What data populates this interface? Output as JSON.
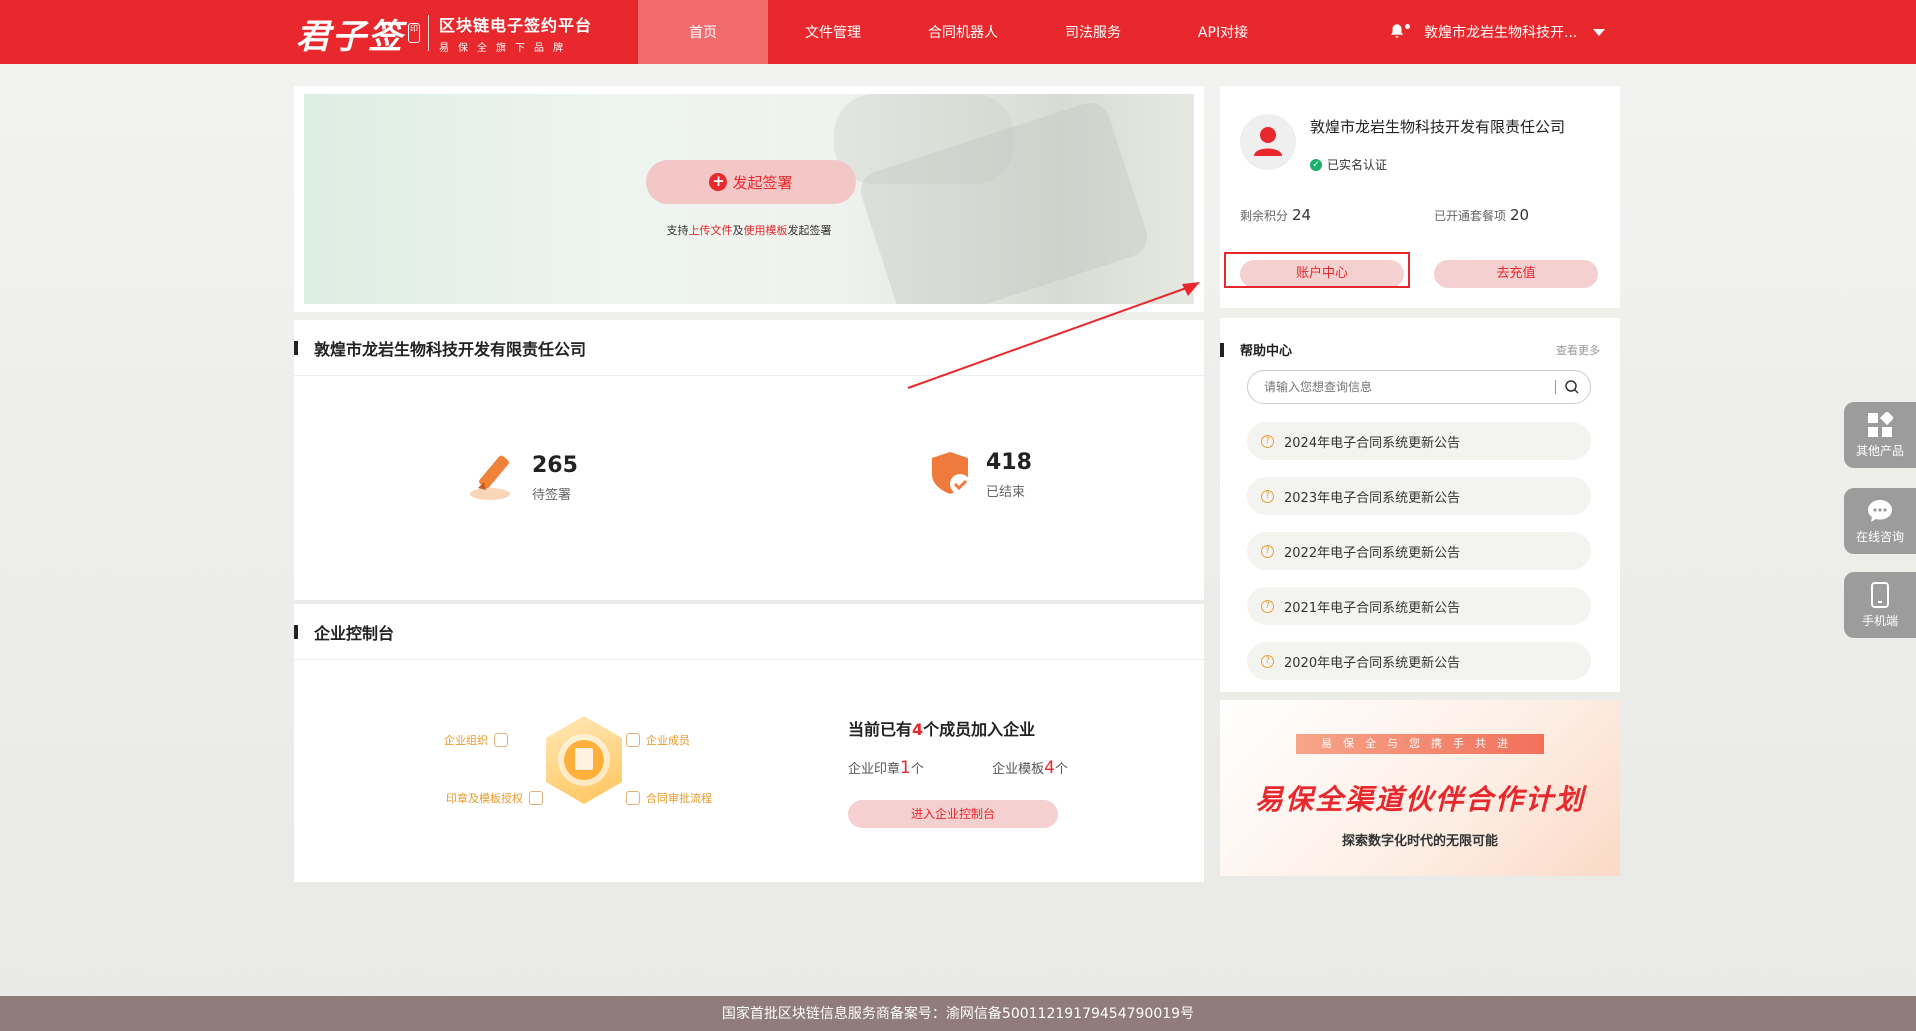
{
  "brand": {
    "logo_mark": "君子签",
    "seal": "印",
    "title": "区块链电子签约平台",
    "subtitle": "易保全旗下品牌"
  },
  "nav": {
    "items": [
      "首页",
      "文件管理",
      "合同机器人",
      "司法服务",
      "API对接"
    ],
    "active": "首页"
  },
  "user_menu": {
    "company": "敦煌市龙岩生物科技开...",
    "bell_icon": "bell-icon",
    "dropdown_icon": "caret-down-icon"
  },
  "hero": {
    "start_button": "发起签署",
    "tip_prefix": "支持",
    "tip_link1": "上传文件",
    "tip_mid": "及",
    "tip_link2": "使用模板",
    "tip_suffix": "发起签署"
  },
  "company": {
    "name": "敦煌市龙岩生物科技开发有限责任公司",
    "stats": [
      {
        "value": "265",
        "label": "待签署",
        "icon": "pen-icon"
      },
      {
        "value": "418",
        "label": "已结束",
        "icon": "shield-check-icon"
      }
    ]
  },
  "console": {
    "title": "企业控制台",
    "tags": [
      "企业组织",
      "企业成员",
      "印章及模板授权",
      "合同审批流程"
    ],
    "members_prefix": "当前已有",
    "members_count": "4",
    "members_suffix": "个成员加入企业",
    "seal_label": "企业印章",
    "seal_count": "1",
    "seal_unit": "个",
    "template_label": "企业模板",
    "template_count": "4",
    "template_unit": "个",
    "enter_button": "进入企业控制台"
  },
  "account": {
    "name": "敦煌市龙岩生物科技开发有限责任公司",
    "verified": "已实名认证",
    "points_label": "剩余积分",
    "points_value": "24",
    "packages_label": "已开通套餐项",
    "packages_value": "20",
    "center_button": "账户中心",
    "recharge_button": "去充值"
  },
  "help": {
    "title": "帮助中心",
    "more": "查看更多",
    "search_placeholder": "请输入您想查询信息",
    "notices": [
      "2024年电子合同系统更新公告",
      "2023年电子合同系统更新公告",
      "2022年电子合同系统更新公告",
      "2021年电子合同系统更新公告",
      "2020年电子合同系统更新公告"
    ]
  },
  "promo": {
    "tag": "易保全与您携手共进",
    "title": "易保全渠道伙伴合作计划",
    "subtitle": "探索数字化时代的无限可能"
  },
  "side_tools": [
    "其他产品",
    "在线咨询",
    "手机端"
  ],
  "footer": {
    "text": "国家首批区块链信息服务商备案号：渝网信备50011219179454790019号"
  },
  "colors": {
    "brand_red": "#e8282c",
    "nav_active": "#f26c6e",
    "footer_bg": "#8f7c7b",
    "verified_green": "#1ab26b"
  }
}
